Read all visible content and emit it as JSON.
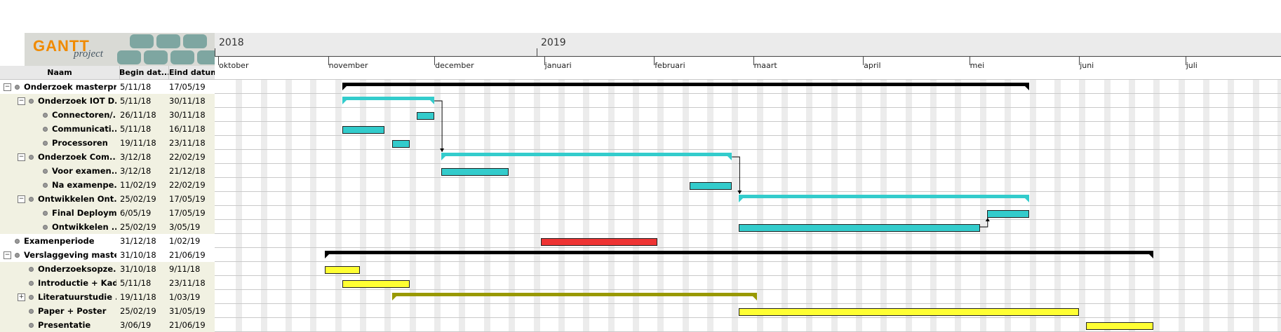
{
  "app": {
    "logo_text_main": "GANTT",
    "logo_text_sub": "project"
  },
  "columns": {
    "name": "Naam",
    "begin": "Begin dat...",
    "end": "Eind datum"
  },
  "timeline": {
    "years": [
      {
        "label": "2018"
      },
      {
        "label": "2019"
      }
    ],
    "months": [
      "oktober",
      "november",
      "december",
      "januari",
      "februari",
      "maart",
      "april",
      "mei",
      "juni",
      "juli"
    ]
  },
  "colors": {
    "cyan": "#33cccc",
    "black": "#000000",
    "red": "#ee3333",
    "yellow": "#ffff33",
    "olive": "#999900"
  },
  "tasks": [
    {
      "name": "Onderzoek masterpr...",
      "begin": "5/11/18",
      "end": "17/05/19",
      "level": 0,
      "expander": "minus",
      "kind": "summary",
      "color": "#000000"
    },
    {
      "name": "Onderzoek IOT D...",
      "begin": "5/11/18",
      "end": "30/11/18",
      "level": 1,
      "expander": "minus",
      "kind": "summary",
      "color": "#33cccc"
    },
    {
      "name": "Connectoren/...",
      "begin": "26/11/18",
      "end": "30/11/18",
      "level": 2,
      "expander": "",
      "kind": "task",
      "color": "#33cccc"
    },
    {
      "name": "Communicati...",
      "begin": "5/11/18",
      "end": "16/11/18",
      "level": 2,
      "expander": "",
      "kind": "task",
      "color": "#33cccc"
    },
    {
      "name": "Processoren",
      "begin": "19/11/18",
      "end": "23/11/18",
      "level": 2,
      "expander": "",
      "kind": "task",
      "color": "#33cccc"
    },
    {
      "name": "Onderzoek Com...",
      "begin": "3/12/18",
      "end": "22/02/19",
      "level": 1,
      "expander": "minus",
      "kind": "summary",
      "color": "#33cccc"
    },
    {
      "name": "Voor examen...",
      "begin": "3/12/18",
      "end": "21/12/18",
      "level": 2,
      "expander": "",
      "kind": "task",
      "color": "#33cccc"
    },
    {
      "name": "Na examenpe...",
      "begin": "11/02/19",
      "end": "22/02/19",
      "level": 2,
      "expander": "",
      "kind": "task",
      "color": "#33cccc"
    },
    {
      "name": "Ontwikkelen Ont...",
      "begin": "25/02/19",
      "end": "17/05/19",
      "level": 1,
      "expander": "minus",
      "kind": "summary",
      "color": "#33cccc"
    },
    {
      "name": "Final Deploym...",
      "begin": "6/05/19",
      "end": "17/05/19",
      "level": 2,
      "expander": "",
      "kind": "task",
      "color": "#33cccc"
    },
    {
      "name": "Ontwikkelen ...",
      "begin": "25/02/19",
      "end": "3/05/19",
      "level": 2,
      "expander": "",
      "kind": "task",
      "color": "#33cccc"
    },
    {
      "name": "Examenperiode",
      "begin": "31/12/18",
      "end": "1/02/19",
      "level": 0,
      "expander": "",
      "kind": "task",
      "color": "#ee3333"
    },
    {
      "name": "Verslaggeving maste...",
      "begin": "31/10/18",
      "end": "21/06/19",
      "level": 0,
      "expander": "minus",
      "kind": "summary",
      "color": "#000000"
    },
    {
      "name": "Onderzoeksopze...",
      "begin": "31/10/18",
      "end": "9/11/18",
      "level": 1,
      "expander": "",
      "kind": "task",
      "color": "#ffff33"
    },
    {
      "name": "Introductie + Kad...",
      "begin": "5/11/18",
      "end": "23/11/18",
      "level": 1,
      "expander": "",
      "kind": "task",
      "color": "#ffff33"
    },
    {
      "name": "Literatuurstudie ...",
      "begin": "19/11/18",
      "end": "1/03/19",
      "level": 1,
      "expander": "plus",
      "kind": "summary",
      "color": "#999900"
    },
    {
      "name": "Paper + Poster",
      "begin": "25/02/19",
      "end": "31/05/19",
      "level": 1,
      "expander": "",
      "kind": "task",
      "color": "#ffff33"
    },
    {
      "name": "Presentatie",
      "begin": "3/06/19",
      "end": "21/06/19",
      "level": 1,
      "expander": "",
      "kind": "task",
      "color": "#ffff33"
    }
  ]
}
